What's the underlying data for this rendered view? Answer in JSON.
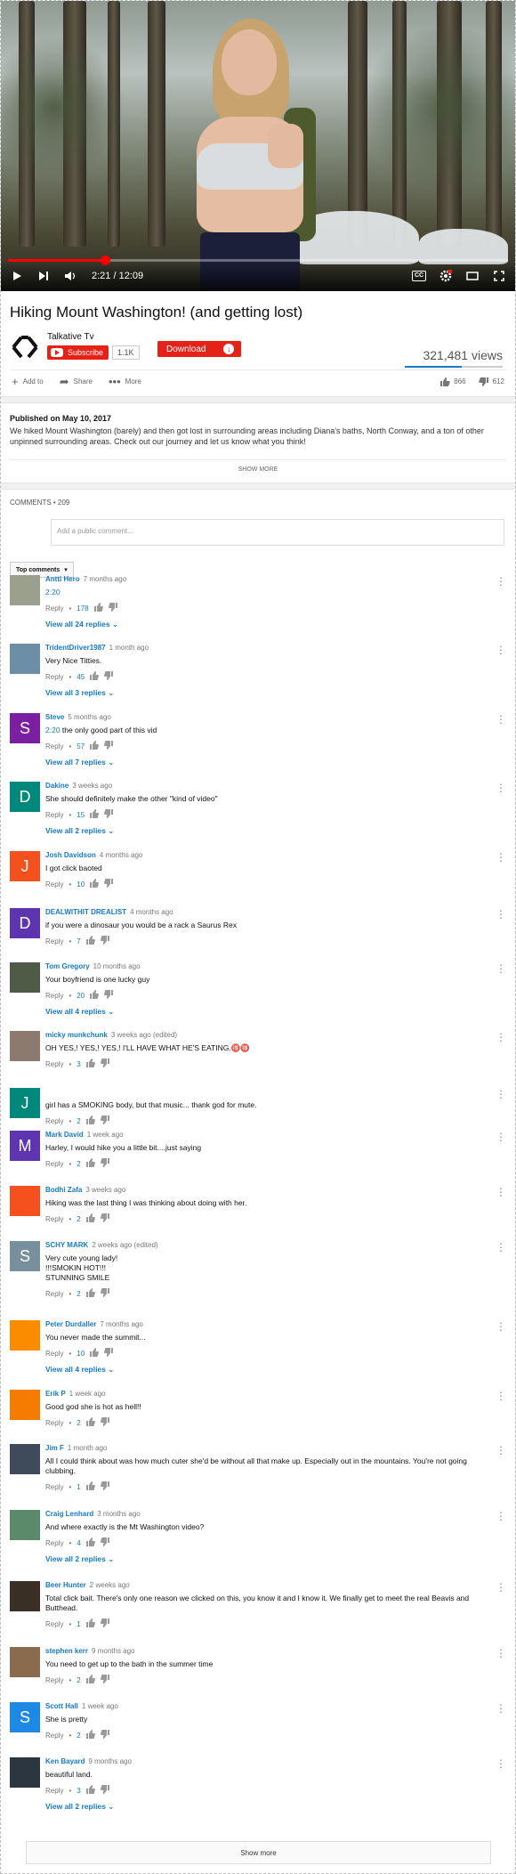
{
  "player": {
    "time": "2:21 / 12:09",
    "progress_fraction": 0.194
  },
  "video": {
    "title": "Hiking Mount Washington! (and getting lost)",
    "channel": "Talkative Tv",
    "subscribe_label": "Subscribe",
    "subscriber_count": "1.1K",
    "download_label": "Download",
    "views": "321,481 views",
    "like_fraction": 0.58,
    "likes": "866",
    "dislikes": "612",
    "actions": {
      "add": "Add to",
      "share": "Share",
      "more": "More"
    }
  },
  "description": {
    "published": "Published on May 10, 2017",
    "text": "We hiked Mount Washington (barely) and then got lost in surrounding areas including Diana's baths, North Conway, and a ton of other unpinned surrounding areas. Check out our journey and let us know what you think!",
    "show_more": "SHOW MORE"
  },
  "comments_section": {
    "header": "COMMENTS • 209",
    "placeholder": "Add a public comment...",
    "sort_label": "Top comments",
    "reply_label": "Reply",
    "show_more": "Show more"
  },
  "comments": [
    {
      "author": "Antti Hero",
      "time": "7 months ago",
      "ts": "2:20",
      "text": "",
      "likes": "178",
      "view_replies": "View all 24 replies",
      "avatar_letter": "",
      "avatar_color": "#9aa08c"
    },
    {
      "author": "TridentDriver1987",
      "time": "1 month ago",
      "ts": "",
      "text": "Very Nice Titties.",
      "likes": "45",
      "view_replies": "View all 3 replies",
      "avatar_letter": "",
      "avatar_color": "#6d8fa6"
    },
    {
      "author": "Steve",
      "time": "5 months ago",
      "ts": "2:20",
      "text": " the only good part of this vid",
      "likes": "57",
      "view_replies": "View all 7 replies",
      "avatar_letter": "S",
      "avatar_color": "#7b1fa2"
    },
    {
      "author": "Dakine",
      "time": "3 weeks ago",
      "ts": "",
      "text": "She should definitely make the other \"kind of video\"",
      "likes": "15",
      "view_replies": "View all 2 replies",
      "avatar_letter": "D",
      "avatar_color": "#00897b"
    },
    {
      "author": "Josh Davidson",
      "time": "4 months ago",
      "ts": "",
      "text": "I got click baoted",
      "likes": "10",
      "view_replies": "",
      "avatar_letter": "J",
      "avatar_color": "#f4511e"
    },
    {
      "author": "DEALWITHIT DREALIST",
      "time": "4 months ago",
      "ts": "",
      "text": "if you were a dinosaur you would be a rack a Saurus Rex",
      "likes": "7",
      "view_replies": "",
      "avatar_letter": "D",
      "avatar_color": "#5e35b1"
    },
    {
      "author": "Tom Gregory",
      "time": "10 months ago",
      "ts": "",
      "text": "Your boyfriend is one lucky guy",
      "likes": "20",
      "view_replies": "View all 4 replies",
      "avatar_letter": "",
      "avatar_color": "#4f5b47"
    },
    {
      "author": "micky munkchunk",
      "time": "3 weeks ago (edited)",
      "ts": "",
      "text": "OH YES,! YES,! YES,! I'LL HAVE WHAT HE'S EATING.🉐🉐",
      "likes": "3",
      "view_replies": "",
      "avatar_letter": "",
      "avatar_color": "#8d7a6e"
    },
    {
      "author": "",
      "time": "",
      "ts": "",
      "text": "girl has a SMOKING body, but that music... thank god for mute.",
      "likes": "2",
      "view_replies": "",
      "avatar_letter": "J",
      "avatar_color": "#00897b"
    },
    {
      "author": "Mark David",
      "time": "1 week ago",
      "ts": "",
      "text": "Harley, I would hike you a little bit....just saying",
      "likes": "2",
      "view_replies": "",
      "avatar_letter": "M",
      "avatar_color": "#5e35b1"
    },
    {
      "author": "Bodhi Zafa",
      "time": "3 weeks ago",
      "ts": "",
      "text": "Hiking was the last thing I was thinking about doing with her.",
      "likes": "2",
      "view_replies": "",
      "avatar_letter": "",
      "avatar_color": "#f4511e"
    },
    {
      "author": "SCHY MARK",
      "time": "2 weeks ago (edited)",
      "ts": "",
      "text": "Very cute young lady!\n!!!SMOKIN HOT!!!\nSTUNNING SMILE",
      "likes": "2",
      "view_replies": "",
      "avatar_letter": "S",
      "avatar_color": "#78909c"
    },
    {
      "author": "Peter Durdaller",
      "time": "7 months ago",
      "ts": "",
      "text": "You never made the summit...",
      "likes": "10",
      "view_replies": "View all 4 replies",
      "avatar_letter": "",
      "avatar_color": "#fb8c00"
    },
    {
      "author": "Erik P",
      "time": "1 week ago",
      "ts": "",
      "text": "Good god she is hot as hell!!",
      "likes": "2",
      "view_replies": "",
      "avatar_letter": "",
      "avatar_color": "#f57c00"
    },
    {
      "author": "Jim F",
      "time": "1 month ago",
      "ts": "",
      "text": "All I could think about was how much cuter she'd be without all that make up.  Especially out in the mountains.  You're not going clubbing.",
      "likes": "1",
      "view_replies": "",
      "avatar_letter": "",
      "avatar_color": "#3f4a5a"
    },
    {
      "author": "Craig Lenhard",
      "time": "3 months ago",
      "ts": "",
      "text": "And where exactly is the Mt Washington video?",
      "likes": "4",
      "view_replies": "View all 2 replies",
      "avatar_letter": "",
      "avatar_color": "#5b8a6a"
    },
    {
      "author": "Beer Hunter",
      "time": "2 weeks ago",
      "ts": "",
      "text": "Total click bait. There's only one reason we clicked on this, you know it and I know it. We finally get to meet the real Beavis and Butthead.",
      "likes": "1",
      "view_replies": "",
      "avatar_letter": "",
      "avatar_color": "#3a2f24"
    },
    {
      "author": "stephen kerr",
      "time": "9 months ago",
      "ts": "",
      "text": "You need to get up to the bath in the summer time",
      "likes": "2",
      "view_replies": "",
      "avatar_letter": "",
      "avatar_color": "#8a6b4e"
    },
    {
      "author": "Scott Hall",
      "time": "1 week ago",
      "ts": "",
      "text": "She is pretty",
      "likes": "2",
      "view_replies": "",
      "avatar_letter": "S",
      "avatar_color": "#1e88e5"
    },
    {
      "author": "Ken Bayard",
      "time": "9 months ago",
      "ts": "",
      "text": "beautiful land.",
      "likes": "3",
      "view_replies": "View all 2 replies",
      "avatar_letter": "",
      "avatar_color": "#2c3640"
    }
  ]
}
